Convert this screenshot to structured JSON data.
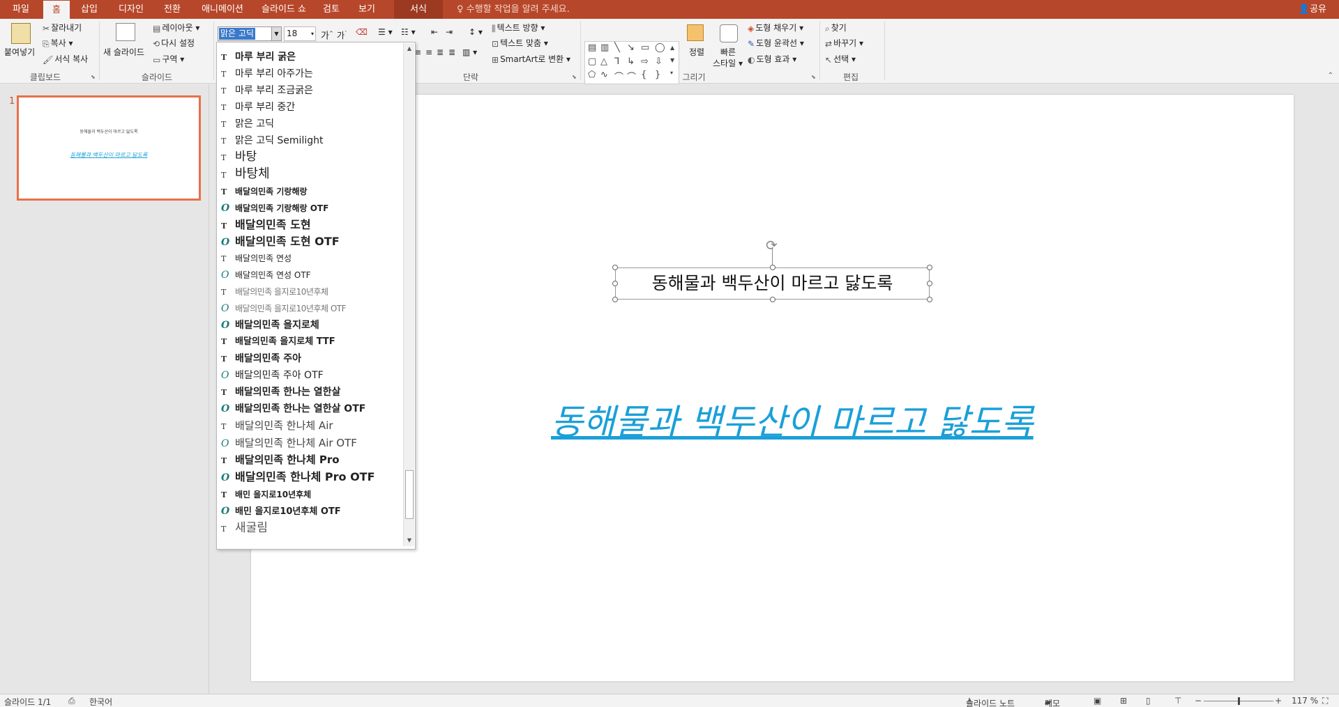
{
  "tabs": [
    "파일",
    "홈",
    "삽입",
    "디자인",
    "전환",
    "애니메이션",
    "슬라이드 쇼",
    "검토",
    "보기",
    "서식"
  ],
  "tell_me": "수행할 작업을 알려 주세요.",
  "share": "공유",
  "ribbon": {
    "clipboard": {
      "paste": "붙여넣기",
      "cut": "잘라내기",
      "copy": "복사",
      "format_painter": "서식 복사",
      "group": "클립보드"
    },
    "slides": {
      "new_slide": "새 슬라이드",
      "layout": "레이아웃",
      "reset": "다시 설정",
      "section": "구역",
      "group": "슬라이드"
    },
    "font": {
      "name": "맑은 고딕",
      "size": "18"
    },
    "paragraph": {
      "text_direction": "텍스트 방향",
      "align_text": "텍스트 맞춤",
      "smartart": "SmartArt로 변환",
      "group": "단락"
    },
    "drawing": {
      "arrange": "정렬",
      "quick_styles_1": "빠른",
      "quick_styles_2": "스타일",
      "shape_fill": "도형 채우기",
      "shape_outline": "도형 윤곽선",
      "shape_effects": "도형 효과",
      "group": "그리기"
    },
    "editing": {
      "find": "찾기",
      "replace": "바꾸기",
      "select": "선택",
      "group": "편집"
    }
  },
  "font_list": [
    {
      "name": "마루 부리 굵은",
      "type": "tt"
    },
    {
      "name": "마루 부리 아주가는",
      "type": "tt"
    },
    {
      "name": "마루 부리 조금굵은",
      "type": "tt"
    },
    {
      "name": "마루 부리 중간",
      "type": "tt"
    },
    {
      "name": "맑은 고딕",
      "type": "tt"
    },
    {
      "name": "맑은 고딕 Semilight",
      "type": "tt"
    },
    {
      "name": "바탕",
      "type": "tt"
    },
    {
      "name": "바탕체",
      "type": "tt"
    },
    {
      "name": "배달의민족 기랑해랑",
      "type": "tt"
    },
    {
      "name": "배달의민족 기랑해랑 OTF",
      "type": "ot"
    },
    {
      "name": "배달의민족 도현",
      "type": "tt"
    },
    {
      "name": "배달의민족 도현 OTF",
      "type": "ot"
    },
    {
      "name": "배달의민족 연성",
      "type": "tt"
    },
    {
      "name": "배달의민족 연성 OTF",
      "type": "ot"
    },
    {
      "name": "배달의민족 을지로10년후체",
      "type": "tt"
    },
    {
      "name": "배달의민족 을지로10년후체 OTF",
      "type": "ot"
    },
    {
      "name": "배달의민족 을지로체",
      "type": "ot"
    },
    {
      "name": "배달의민족 을지로체 TTF",
      "type": "tt"
    },
    {
      "name": "배달의민족 주아",
      "type": "tt"
    },
    {
      "name": "배달의민족 주아 OTF",
      "type": "ot"
    },
    {
      "name": "배달의민족 한나는 열한살",
      "type": "tt"
    },
    {
      "name": "배달의민족 한나는 열한살 OTF",
      "type": "ot"
    },
    {
      "name": "배달의민족 한나체 Air",
      "type": "tt"
    },
    {
      "name": "배달의민족 한나체 Air OTF",
      "type": "ot"
    },
    {
      "name": "배달의민족 한나체 Pro",
      "type": "tt"
    },
    {
      "name": "배달의민족 한나체 Pro OTF",
      "type": "ot"
    },
    {
      "name": "배민 을지로10년후체",
      "type": "tt"
    },
    {
      "name": "배민 을지로10년후체 OTF",
      "type": "ot"
    },
    {
      "name": "새굴림",
      "type": "tt"
    }
  ],
  "slide": {
    "number": "1",
    "text_box": "동해물과 백두산이 마르고 닳도록",
    "wordart": "동해물과 백두산이 마르고 닳도록"
  },
  "status": {
    "slide_count": "슬라이드 1/1",
    "language": "한국어",
    "notes": "슬라이드 노트",
    "comments": "메모",
    "zoom": "117 %"
  }
}
